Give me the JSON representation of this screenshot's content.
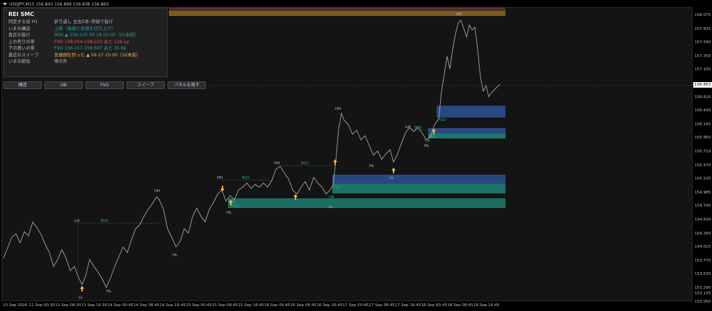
{
  "symbol_bar": {
    "text": "USDJPY,M15  156.843 156.896 156.838 156.863"
  },
  "panel": {
    "title": "REI SMC",
    "rows": [
      {
        "label": "判定する足 H1",
        "value": "折り返し 左右5本･终値で抜け",
        "color": "default"
      },
      {
        "label": "いまの構造",
        "value": "上昇（高値と安値を切り上げ）",
        "color": "teal"
      },
      {
        "label": "直近の抜け",
        "value": "BOS ▲ 156.105  09.18 02:00（21本前）",
        "color": "teal"
      },
      {
        "label": "上の売りの帯",
        "value": "FVG 158.054-158.223  あと 119.1p",
        "color": "red"
      },
      {
        "label": "下の買いの帯",
        "value": "FVG 156.317-156.507  あと 35.6p",
        "color": "teal"
      },
      {
        "label": "直近のスイープ",
        "value": "安値側を狩った ▲ 09.17 15:00（32本前）",
        "color": "gold"
      },
      {
        "label": "いまの絶段",
        "value": "帯の外",
        "color": "default"
      }
    ]
  },
  "buttons": [
    {
      "label": "構造",
      "name": "structure-button"
    },
    {
      "label": "OB",
      "name": "ob-button"
    },
    {
      "label": "FVG",
      "name": "fvg-button"
    },
    {
      "label": "スイープ",
      "name": "sweep-button",
      "accent": "#f5b840"
    },
    {
      "label": "パネルを隠す",
      "name": "hide-panel-button"
    }
  ],
  "price_axis": {
    "current": "156.863",
    "ticks": [
      "158.075",
      "157.835",
      "157.590",
      "157.350",
      "157.105",
      "156.863",
      "156.620",
      "156.430",
      "156.195",
      "155.950",
      "155.710",
      "155.470",
      "155.225",
      "154.985",
      "154.745",
      "154.500",
      "154.260",
      "154.015",
      "153.775",
      "153.530",
      "153.290",
      "153.050"
    ],
    "bottom_tick": "153.135"
  },
  "time_axis": {
    "ticks": [
      "10 Sep 2026",
      "11 Sep 00:30",
      "11 Sep 08:30",
      "11 Sep 16:30",
      "14 Sep 00:45",
      "14 Sep 08:45",
      "14 Sep 16:45",
      "15 Sep 00:45",
      "15 Sep 08:45",
      "15 Sep 16:45",
      "16 Sep 00:45",
      "16 Sep 08:45",
      "16 Sep 16:45",
      "17 Sep 00:45",
      "17 Sep 08:45",
      "17 Sep 16:45",
      "18 Sep 00:45",
      "18 Sep 08:45",
      "18 Sep 16:45"
    ]
  },
  "chart_labels": {
    "swings": [
      "HH",
      "HH",
      "HH",
      "HH",
      "HH",
      "LH",
      "LH",
      "HL",
      "HL",
      "HL",
      "HL",
      "LL",
      "LL",
      "LL",
      "HL"
    ],
    "bos": [
      "BOS",
      "BOS",
      "BOS",
      "BOS",
      "BOS"
    ],
    "fvg": [
      "FVG",
      "FVG*",
      "FVG*",
      "FVG",
      "OB",
      "OB"
    ]
  },
  "colors": {
    "bg": "#141414",
    "candle": "#a8a8a8",
    "bull_zone": "#1e8a7a",
    "bear_zone": "#2b4f8a",
    "sell_band": "#7a5a20",
    "top_band": "#6a2a3a",
    "arrow": "#f5b840",
    "bos_line": "#26a69a",
    "lh_line": "#26a69a"
  }
}
